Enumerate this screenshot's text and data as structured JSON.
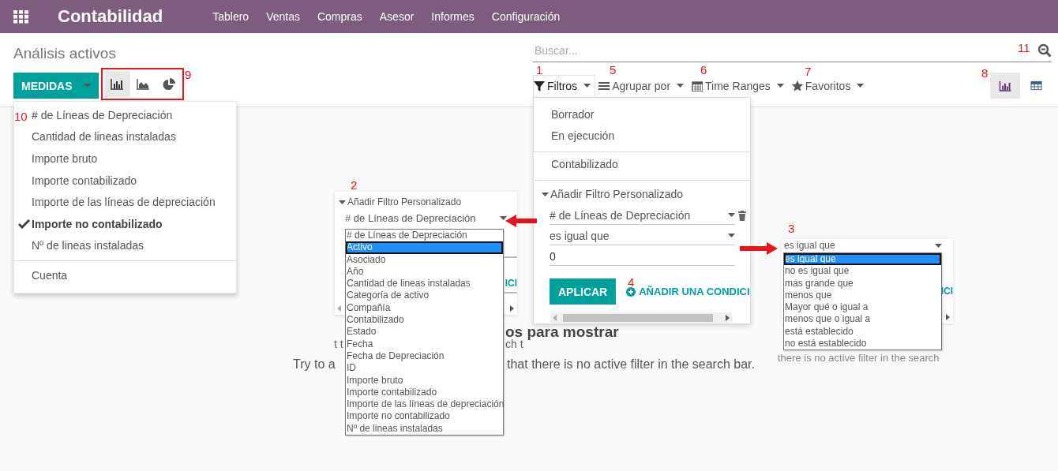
{
  "navbar": {
    "app_title": "Contabilidad",
    "menu": [
      "Tablero",
      "Ventas",
      "Compras",
      "Asesor",
      "Informes",
      "Configuración"
    ]
  },
  "breadcrumb": "Análisis activos",
  "search": {
    "placeholder": "Buscar..."
  },
  "measures_button": "MEDIDAS",
  "graph_modes": [
    {
      "kind": "bar",
      "selected": true
    },
    {
      "kind": "area",
      "selected": false
    },
    {
      "kind": "pie",
      "selected": false
    }
  ],
  "search_options": [
    {
      "kind": "filter",
      "label": "Filtros",
      "selected": true
    },
    {
      "kind": "group",
      "label": "Agrupar por",
      "selected": false
    },
    {
      "kind": "calendar",
      "label": "Time Ranges",
      "selected": false
    },
    {
      "kind": "star",
      "label": "Favoritos",
      "selected": false
    }
  ],
  "views": [
    {
      "kind": "graph",
      "selected": true
    },
    {
      "kind": "pivot",
      "selected": false
    }
  ],
  "measures_menu": {
    "items": [
      {
        "label": "# de Líneas de Depreciación",
        "checked": false
      },
      {
        "label": "Cantidad de lineas instaladas",
        "checked": false
      },
      {
        "label": "Importe bruto",
        "checked": false
      },
      {
        "label": "Importe contabilizado",
        "checked": false
      },
      {
        "label": "Importe de las líneas de depreciación",
        "checked": false
      },
      {
        "label": "Importe no contabilizado",
        "checked": true
      },
      {
        "label": "Nº de lineas instaladas",
        "checked": false
      }
    ],
    "extra": "Cuenta"
  },
  "filters_menu": {
    "groups": [
      [
        "Borrador",
        "En ejecución"
      ],
      [
        "Contabilizado"
      ]
    ],
    "custom_filter": "Añadir Filtro Personalizado",
    "field": "# de Líneas de Depreciación",
    "operator": "es igual que",
    "value": "0",
    "apply": "APLICAR",
    "add_condition": "AÑADIR UNA CONDICI"
  },
  "field_dropdown": {
    "header": "Añadir Filtro Personalizado",
    "field": "# de Líneas de Depreciación",
    "cut_text": "ICI",
    "options": [
      {
        "label": "# de Líneas de Depreciación",
        "selected": false
      },
      {
        "label": "Activo",
        "selected": true
      },
      {
        "label": "Asociado",
        "selected": false
      },
      {
        "label": "Año",
        "selected": false
      },
      {
        "label": "Cantidad de lineas instaladas",
        "selected": false
      },
      {
        "label": "Categoría de activo",
        "selected": false
      },
      {
        "label": "Compañía",
        "selected": false
      },
      {
        "label": "Contabilizado",
        "selected": false
      },
      {
        "label": "Estado",
        "selected": false
      },
      {
        "label": "Fecha",
        "selected": false
      },
      {
        "label": "Fecha de Depreciación",
        "selected": false
      },
      {
        "label": "ID",
        "selected": false
      },
      {
        "label": "Importe bruto",
        "selected": false
      },
      {
        "label": "Importe contabilizado",
        "selected": false
      },
      {
        "label": "Importe de las líneas de depreciación",
        "selected": false
      },
      {
        "label": "Importe no contabilizado",
        "selected": false
      },
      {
        "label": "Nº de lineas instaladas",
        "selected": false
      }
    ]
  },
  "operator_dropdown": {
    "value": "es igual que",
    "cut_text": "ICI",
    "options": [
      {
        "label": "es igual que",
        "selected": true
      },
      {
        "label": "no es igual que",
        "selected": false
      },
      {
        "label": "mas grande que",
        "selected": false
      },
      {
        "label": "menos que",
        "selected": false
      },
      {
        "label": "Mayor qué o igual a",
        "selected": false
      },
      {
        "label": "menos que o igual a",
        "selected": false
      },
      {
        "label": "está establecido",
        "selected": false
      },
      {
        "label": "no está establecido",
        "selected": false
      }
    ]
  },
  "empty_state": {
    "title_fragment": "os para mostrar",
    "fragments": [
      "t t",
      "ch t",
      "there is no active filter in the search"
    ],
    "text_start": "Try to a",
    "text_end": "that there is no active filter in the search bar."
  },
  "annotations": [
    "11",
    "9",
    "1",
    "5",
    "6",
    "7",
    "8",
    "10",
    "2",
    "3",
    "4"
  ]
}
